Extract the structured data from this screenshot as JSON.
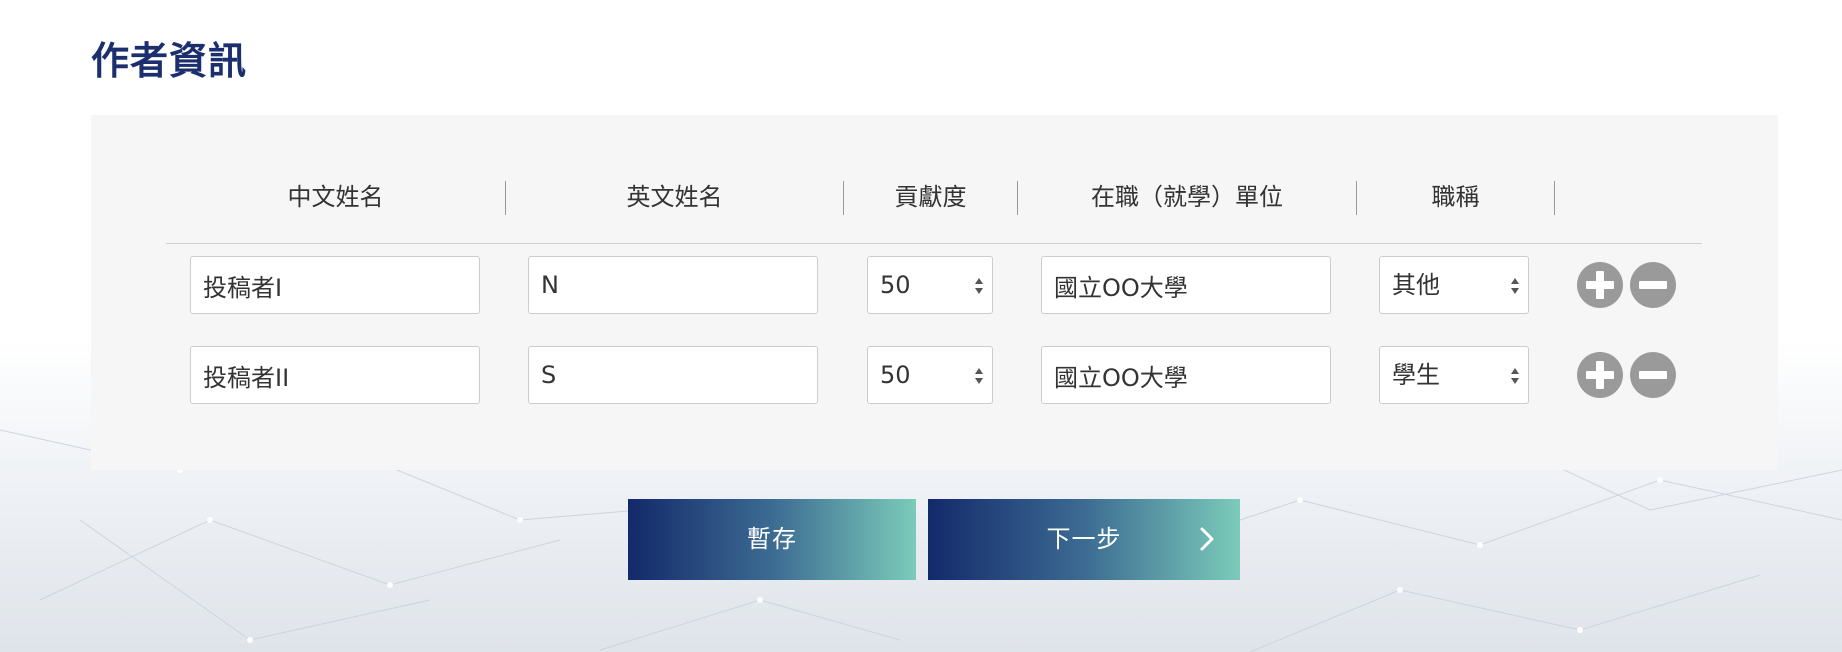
{
  "page": {
    "title": "作者資訊"
  },
  "table": {
    "headers": [
      "中文姓名",
      "英文姓名",
      "貢獻度",
      "在職（就學）單位",
      "職稱"
    ],
    "rows": [
      {
        "chinese_name": "投稿者I",
        "english_name": "N",
        "contribution": "50",
        "affiliation": "國立OO大學",
        "job_title": "其他"
      },
      {
        "chinese_name": "投稿者II",
        "english_name": "S",
        "contribution": "50",
        "affiliation": "國立OO大學",
        "job_title": "學生"
      }
    ]
  },
  "actions": {
    "save_label": "暫存",
    "next_label": "下一步"
  },
  "icons": {
    "add": "plus-circle-icon",
    "remove": "minus-circle-icon",
    "select_arrows": "up-down-arrows-icon",
    "next": "chevron-right-icon"
  },
  "colors": {
    "title": "#1b2f6e",
    "panel_bg": "#f6f6f6",
    "round_button": "#9a9a9a",
    "gradient_start": "#13296b",
    "gradient_end": "#7bcbba"
  }
}
